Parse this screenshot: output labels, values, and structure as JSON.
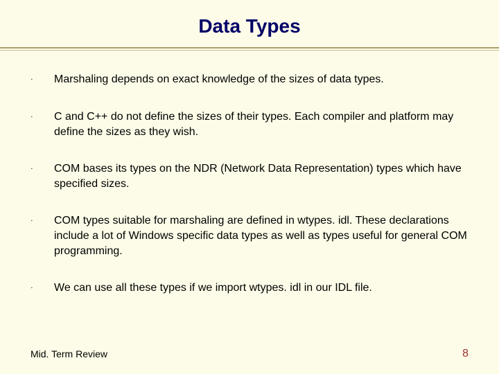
{
  "title": "Data Types",
  "bullets": [
    "Marshaling depends on exact knowledge of the sizes of data types.",
    "C and C++ do not define the sizes of their types.  Each compiler and platform may define the sizes as they wish.",
    "COM bases its types on the NDR (Network Data Representation) types which have specified sizes.",
    "COM types suitable for marshaling are defined in wtypes. idl.  These declarations include a lot of Windows specific data types as well as types useful for general COM programming.",
    "We can use all these types if we import wtypes. idl in our IDL file."
  ],
  "footer_text": "Mid. Term Review",
  "page_number": "8",
  "bullet_glyph": "·"
}
